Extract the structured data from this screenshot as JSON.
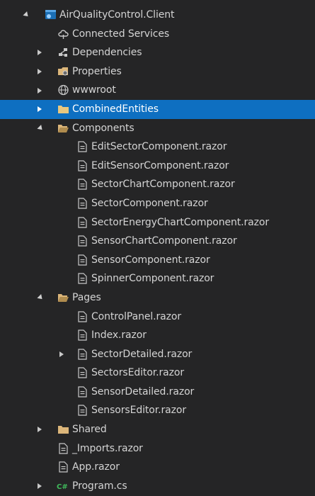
{
  "tree": {
    "root": {
      "label": "AirQualityControl.Client",
      "icon": "project-icon"
    },
    "connected_services": {
      "label": "Connected Services",
      "icon": "connected-services-icon"
    },
    "dependencies": {
      "label": "Dependencies",
      "icon": "dependencies-icon"
    },
    "properties": {
      "label": "Properties",
      "icon": "properties-icon"
    },
    "wwwroot": {
      "label": "wwwroot",
      "icon": "globe-icon"
    },
    "combined_entities": {
      "label": "CombinedEntities",
      "icon": "folder-icon"
    },
    "components": {
      "label": "Components",
      "icon": "folder-open-icon",
      "files": [
        "EditSectorComponent.razor",
        "EditSensorComponent.razor",
        "SectorChartComponent.razor",
        "SectorComponent.razor",
        "SectorEnergyChartComponent.razor",
        "SensorChartComponent.razor",
        "SensorComponent.razor",
        "SpinnerComponent.razor"
      ]
    },
    "pages": {
      "label": "Pages",
      "icon": "folder-open-icon",
      "files": [
        "ControlPanel.razor",
        "Index.razor",
        "SectorDetailed.razor",
        "SectorsEditor.razor",
        "SensorDetailed.razor",
        "SensorsEditor.razor"
      ]
    },
    "shared": {
      "label": "Shared",
      "icon": "folder-icon"
    },
    "imports": {
      "label": "_Imports.razor",
      "icon": "razor-file-icon"
    },
    "app": {
      "label": "App.razor",
      "icon": "razor-file-icon"
    },
    "program": {
      "label": "Program.cs",
      "icon": "csharp-file-icon"
    }
  },
  "colors": {
    "background": "#252526",
    "selection": "#0e6fc1",
    "folder": "#dcb67a",
    "text": "#d4d4d4"
  }
}
